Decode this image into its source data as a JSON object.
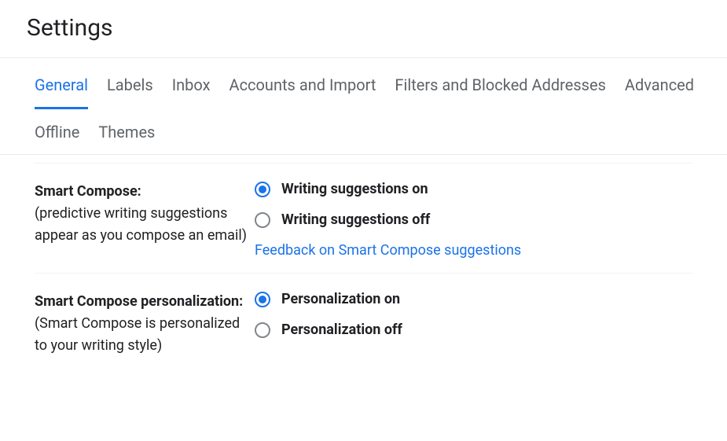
{
  "page_title": "Settings",
  "tabs": [
    {
      "label": "General",
      "active": true
    },
    {
      "label": "Labels",
      "active": false
    },
    {
      "label": "Inbox",
      "active": false
    },
    {
      "label": "Accounts and Import",
      "active": false
    },
    {
      "label": "Filters and Blocked Addresses",
      "active": false
    },
    {
      "label": "Advanced",
      "active": false
    },
    {
      "label": "Offline",
      "active": false
    },
    {
      "label": "Themes",
      "active": false
    }
  ],
  "settings": {
    "smart_compose": {
      "title": "Smart Compose:",
      "desc": "(predictive writing suggestions appear as you compose an email)",
      "options": [
        {
          "label": "Writing suggestions on",
          "checked": true
        },
        {
          "label": "Writing suggestions off",
          "checked": false
        }
      ],
      "link": "Feedback on Smart Compose suggestions"
    },
    "smart_compose_personalization": {
      "title": "Smart Compose personalization:",
      "desc": "(Smart Compose is personalized to your writing style)",
      "options": [
        {
          "label": "Personalization on",
          "checked": true
        },
        {
          "label": "Personalization off",
          "checked": false
        }
      ]
    }
  }
}
